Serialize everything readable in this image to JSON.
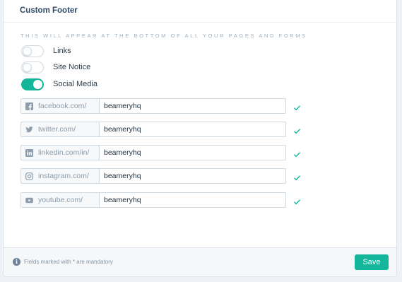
{
  "header": {
    "title": "Custom Footer",
    "subtitle": "This will appear at the bottom of all your pages and forms"
  },
  "toggles": [
    {
      "label": "Links",
      "on": false
    },
    {
      "label": "Site Notice",
      "on": false
    },
    {
      "label": "Social Media",
      "on": true
    }
  ],
  "social": [
    {
      "network": "facebook",
      "icon": "facebook-icon",
      "prefix": "facebook.com/",
      "value": "beameryhq"
    },
    {
      "network": "twitter",
      "icon": "twitter-icon",
      "prefix": "twitter.com/",
      "value": "beameryhq"
    },
    {
      "network": "linkedin",
      "icon": "linkedin-icon",
      "prefix": "linkedin.com/in/",
      "value": "beameryhq"
    },
    {
      "network": "instagram",
      "icon": "instagram-icon",
      "prefix": "instagram.com/",
      "value": "beameryhq"
    },
    {
      "network": "youtube",
      "icon": "youtube-icon",
      "prefix": "youtube.com/",
      "value": "beameryhq"
    }
  ],
  "footer": {
    "note": "Fields marked with * are mandatory",
    "save_label": "Save"
  },
  "colors": {
    "accent": "#13b69a",
    "title": "#2e4a66",
    "muted": "#8d9dab"
  }
}
